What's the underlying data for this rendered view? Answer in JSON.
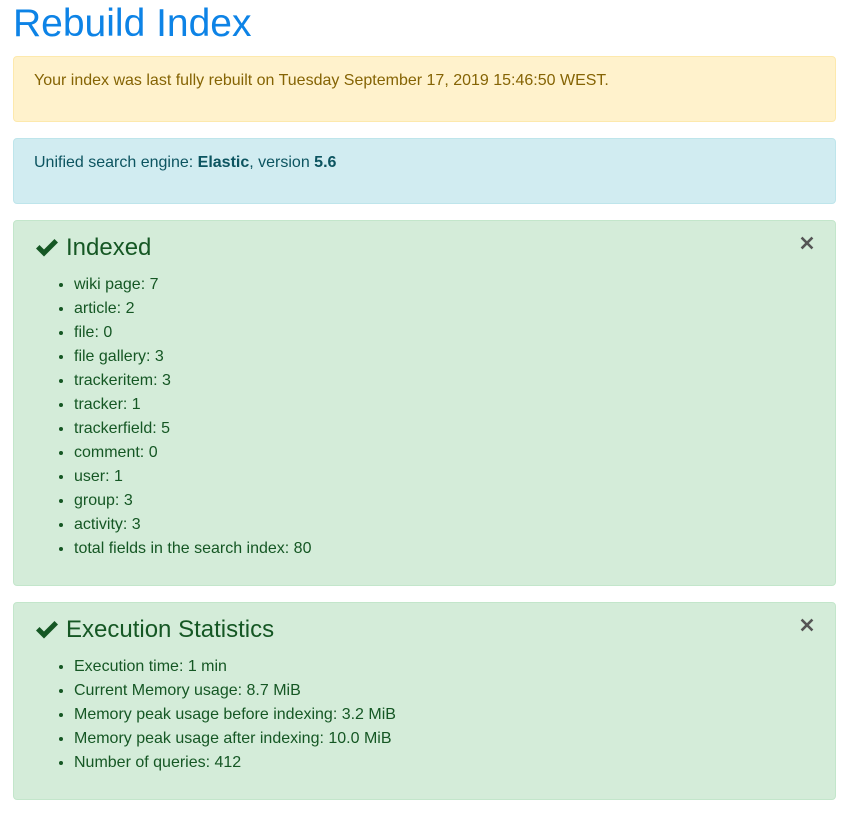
{
  "page": {
    "title": "Rebuild Index"
  },
  "warning": {
    "text": "Your index was last fully rebuilt on Tuesday September 17, 2019 15:46:50 WEST."
  },
  "info": {
    "prefix": "Unified search engine: ",
    "engine": "Elastic",
    "middle": ", version ",
    "version": "5.6"
  },
  "indexed": {
    "icon": "check-icon",
    "title": "Indexed",
    "close_icon": "close-icon",
    "items": [
      "wiki page: 7",
      "article: 2",
      "file: 0",
      "file gallery: 3",
      "trackeritem: 3",
      "tracker: 1",
      "trackerfield: 5",
      "comment: 0",
      "user: 1",
      "group: 3",
      "activity: 3",
      "total fields in the search index: 80"
    ]
  },
  "stats": {
    "icon": "check-icon",
    "title": "Execution Statistics",
    "close_icon": "close-icon",
    "items": [
      "Execution time: 1 min",
      "Current Memory usage: 8.7 MiB",
      "Memory peak usage before indexing: 3.2 MiB",
      "Memory peak usage after indexing: 10.0 MiB",
      "Number of queries: 412"
    ]
  },
  "colors": {
    "title": "#0d83e6",
    "warning_bg": "#fff2cc",
    "warning_text": "#856404",
    "info_bg": "#d1ecf1",
    "info_text": "#0c5460",
    "success_bg": "#d4ecd9",
    "success_text": "#155724"
  }
}
